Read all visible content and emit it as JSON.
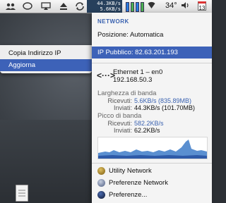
{
  "menubar": {
    "icons": [
      "people-icon",
      "speech-bubble-icon",
      "airplay-icon",
      "eject-icon",
      "sync-icon"
    ],
    "net_meter": {
      "up": "44.3KB/s",
      "down": "5.6KB/s"
    },
    "temperature": "34°",
    "calendar_day": "13"
  },
  "context_menu": {
    "items": [
      "Copia Indirizzo IP",
      "Aggiorna"
    ]
  },
  "panel": {
    "header": "NETWORK",
    "position": "Posizione: Automatica",
    "public_ip": "IP Pubblico: 82.63.201.193",
    "interface": {
      "name": "Ethernet 1 – en0",
      "ip": "192.168.50.3"
    },
    "bandwidth": {
      "title": "Larghezza di banda",
      "received_label": "Ricevuti:",
      "received_value": "5.6KB/s (835.89MB)",
      "sent_label": "Inviati:",
      "sent_value": "44.3KB/s (101.70MB)"
    },
    "peak": {
      "title": "Picco di banda",
      "received_label": "Ricevuti:",
      "received_value": "582.2KB/s",
      "sent_label": "Inviati:",
      "sent_value": "62.2KB/s"
    },
    "menu": [
      "Utility Network",
      "Preferenze Network",
      "Preferenze..."
    ]
  },
  "colors": {
    "accent": "#3d62b8",
    "graph": "#5a8fd0"
  }
}
